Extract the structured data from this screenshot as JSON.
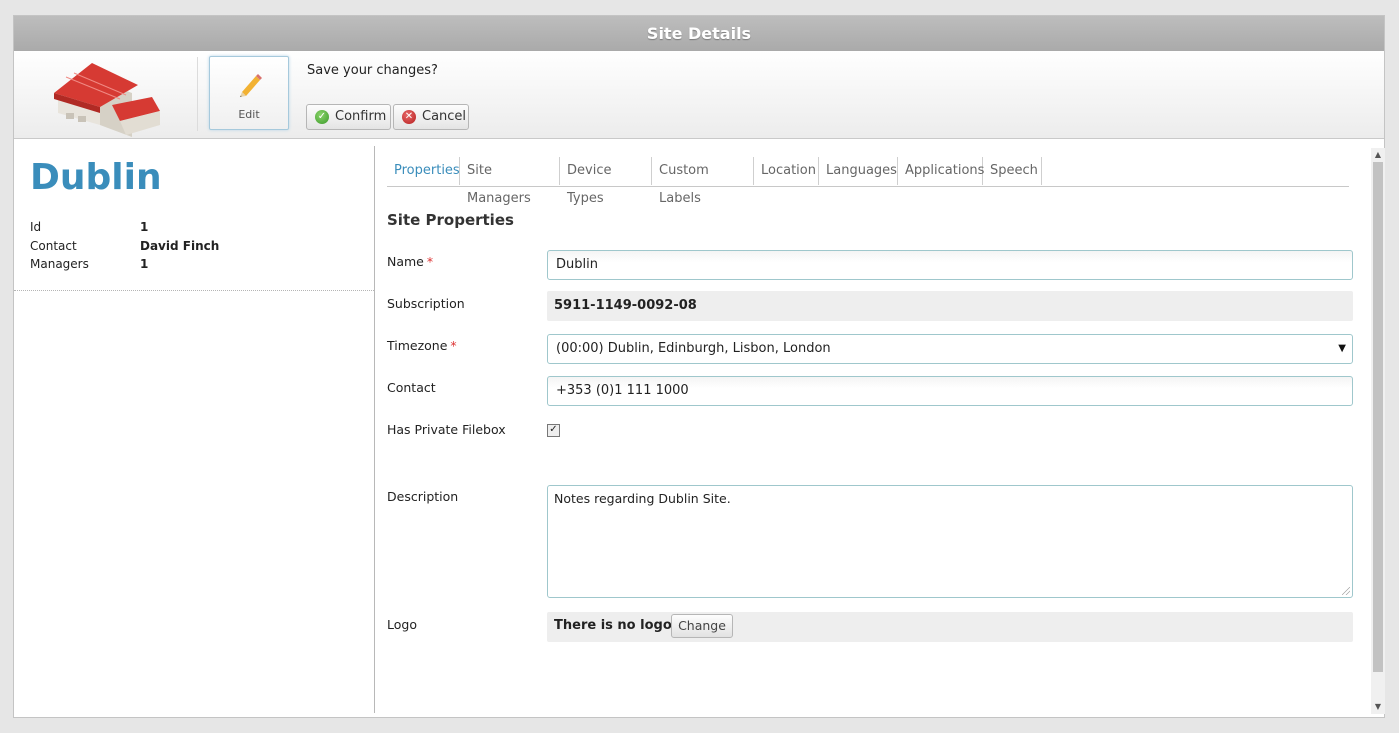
{
  "window": {
    "title": "Site Details"
  },
  "toolbar": {
    "edit_label": "Edit",
    "prompt": "Save your changes?",
    "confirm_label": "Confirm",
    "cancel_label": "Cancel"
  },
  "site": {
    "name": "Dublin",
    "info": [
      {
        "key": "Id",
        "value": "1"
      },
      {
        "key": "Contact",
        "value": "David Finch"
      },
      {
        "key": "Managers",
        "value": "1"
      }
    ]
  },
  "tabs": [
    "Properties",
    "Site Managers",
    "Device Types",
    "Custom Labels",
    "Location",
    "Languages",
    "Applications",
    "Speech"
  ],
  "active_tab": "Properties",
  "form": {
    "section_title": "Site Properties",
    "name_label": "Name",
    "name_value": "Dublin",
    "subscription_label": "Subscription",
    "subscription_value": "5911-1149-0092-08",
    "timezone_label": "Timezone",
    "timezone_value": "(00:00) Dublin, Edinburgh, Lisbon, London",
    "contact_label": "Contact",
    "contact_value": "+353 (0)1 111 1000",
    "filebox_label": "Has Private Filebox",
    "filebox_checked": true,
    "description_label": "Description",
    "description_value": "Notes regarding Dublin Site.",
    "logo_label": "Logo",
    "logo_status": "There is no logo",
    "logo_change_label": "Change",
    "required_mark": "*"
  },
  "colors": {
    "accent": "#3a8dbb",
    "required": "#dd3333",
    "titlebar": "#aaaaaa"
  }
}
